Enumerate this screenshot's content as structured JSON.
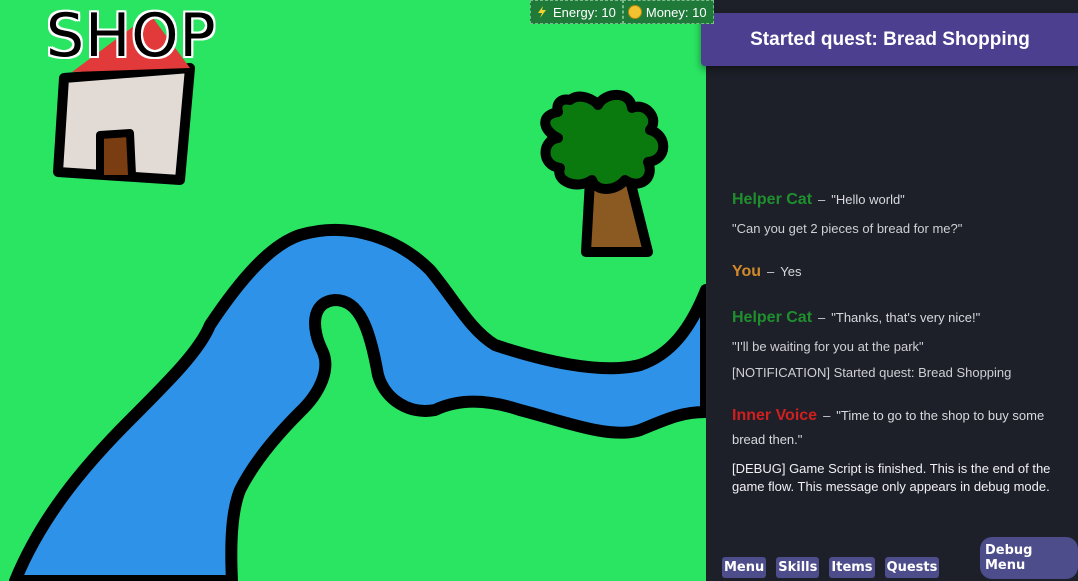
{
  "map": {
    "location_label": "SHOP",
    "colors": {
      "grass": "#2ae562",
      "river": "#2e93e8",
      "outline": "#000000"
    }
  },
  "stats": {
    "energy_label": "Energy: 10",
    "money_label": "Money: 10"
  },
  "quest_banner": "Started quest: Bread Shopping",
  "log": [
    {
      "speaker": "Helper Cat",
      "speaker_color": "#1f8f2e",
      "first": "\"Hello world\"",
      "lines": [
        "\"Can you get 2 pieces of bread for me?\""
      ]
    },
    {
      "speaker": "You",
      "speaker_color": "#d08a2a",
      "first": "Yes",
      "lines": []
    },
    {
      "speaker": "Helper Cat",
      "speaker_color": "#1f8f2e",
      "first": "\"Thanks, that's very nice!\"",
      "lines": [
        "\"I'll be waiting for you at the park\"",
        "[NOTIFICATION] Started quest: Bread Shopping"
      ]
    },
    {
      "speaker": "Inner Voice",
      "speaker_color": "#d01f1f",
      "first": "\"Time to go to the shop to buy some bread then.\"",
      "lines": [
        "[DEBUG] Game Script is finished. This is the end of the game flow. This message only appears in debug mode."
      ]
    }
  ],
  "separator": "–",
  "buttons": {
    "menu": "Menu",
    "skills": "Skills",
    "items": "Items",
    "quests": "Quests",
    "debug": "Debug Menu"
  }
}
